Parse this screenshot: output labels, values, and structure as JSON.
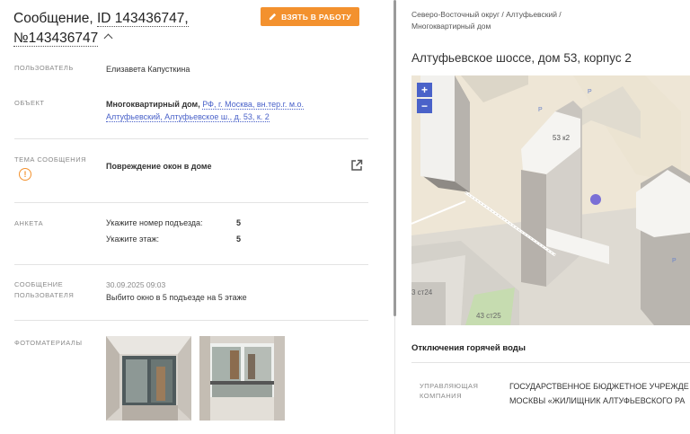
{
  "message": {
    "title_prefix": "Сообщение,",
    "title_id": "ID 143436747,",
    "title_num": "№143436747",
    "take_button": "ВЗЯТЬ В РАБОТУ"
  },
  "fields": {
    "user_label": "ПОЛЬЗОВАТЕЛЬ",
    "user_value": "Елизавета Капусткина",
    "object_label": "ОБЪЕКТ",
    "object_type": "Многоквартирный дом,",
    "object_address_line1": "РФ, г. Москва, вн.тер.г. м.о.",
    "object_address_line2": "Алтуфьевский, Алтуфьевское ш., д. 53, к. 2",
    "topic_label": "ТЕМА СООБЩЕНИЯ",
    "topic_value": "Повреждение окон в доме",
    "survey_label": "АНКЕТА",
    "survey": [
      {
        "question": "Укажите номер подъезда:",
        "answer": "5"
      },
      {
        "question": "Укажите этаж:",
        "answer": "5"
      }
    ],
    "user_message_label_1": "СООБЩЕНИЕ",
    "user_message_label_2": "ПОЛЬЗОВАТЕЛЯ",
    "user_message_date": "30.09.2025 09:03",
    "user_message_text": "Выбито окно в 5 подъезде на 5 этаже",
    "photos_label": "ФОТОМАТЕРИАЛЫ"
  },
  "right": {
    "breadcrumb_line1": "Северо-Восточный округ / Алтуфьевский /",
    "breadcrumb_line2": "Многоквартирный дом",
    "address_title": "Алтуфьевское шоссе, дом 53, корпус 2",
    "map": {
      "zoom_in": "+",
      "zoom_out": "−",
      "building_label": "53 к2",
      "label_st24": "3 ст24",
      "label_st25": "43 ст25",
      "parking": "P"
    },
    "outage_title": "Отключения горячей воды",
    "mgmt_label_1": "УПРАВЛЯЮЩАЯ",
    "mgmt_label_2": "КОМПАНИЯ",
    "mgmt_value_line1": "ГОСУДАРСТВЕННОЕ БЮДЖЕТНОЕ УЧРЕЖДЕ",
    "mgmt_value_line2": "МОСКВЫ «ЖИЛИЩНИК АЛТУФЬЕВСКОГО РА"
  },
  "colors": {
    "accent": "#f3912e",
    "link": "#4a62c9",
    "map_bg": "#eee6d6"
  }
}
